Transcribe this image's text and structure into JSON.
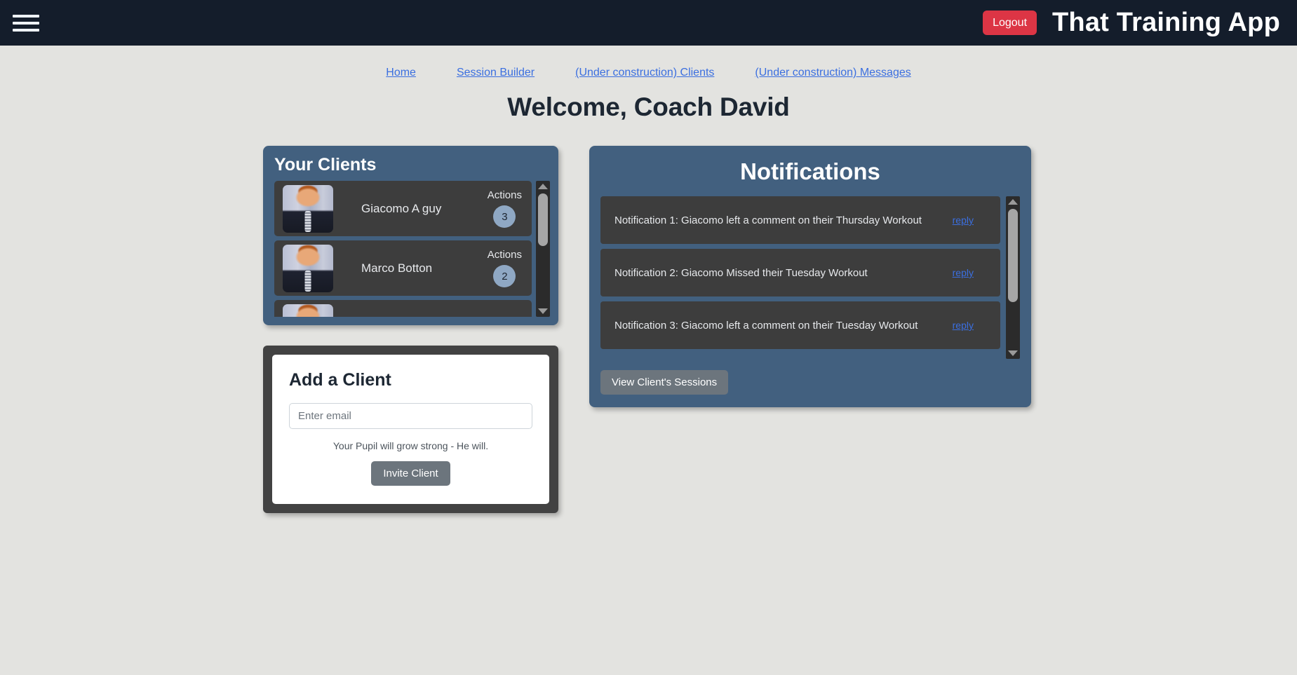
{
  "navbar": {
    "menu_icon": "hamburger-icon",
    "logout_label": "Logout",
    "brand": "That Training App"
  },
  "nav_links": [
    {
      "label": "Home"
    },
    {
      "label": "Session Builder"
    },
    {
      "label": "(Under construction) Clients"
    },
    {
      "label": "(Under construction) Messages"
    }
  ],
  "page_title": "Welcome, Coach David",
  "clients_card": {
    "title": "Your Clients",
    "actions_label": "Actions",
    "clients": [
      {
        "name": "Giacomo A guy",
        "actions_count": "3"
      },
      {
        "name": "Marco Botton",
        "actions_count": "2"
      },
      {
        "name": "",
        "actions_count": ""
      }
    ]
  },
  "add_client_card": {
    "title": "Add a Client",
    "email_placeholder": "Enter email",
    "email_value": "",
    "helper_text": "Your Pupil will grow strong - He will.",
    "invite_label": "Invite Client"
  },
  "notifications_card": {
    "title": "Notifications",
    "reply_label": "reply",
    "items": [
      {
        "text": "Notification 1: Giacomo left a comment on their Thursday Workout",
        "reply": "reply"
      },
      {
        "text": "Notification 2: Giacomo Missed their Tuesday Workout",
        "reply": "reply"
      },
      {
        "text": "Notification 3: Giacomo left a comment on their Tuesday Workout",
        "reply": "reply"
      }
    ],
    "view_sessions_label": "View Client's Sessions"
  },
  "colors": {
    "navbar_bg": "#141d2b",
    "page_bg": "#e3e3e0",
    "card_blue": "#42607f",
    "row_dark": "#3d3d3d",
    "logout_red": "#dc3545",
    "link_blue": "#3b6fe0",
    "button_gray": "#6c757d",
    "badge_blue": "#8fa8c4"
  }
}
